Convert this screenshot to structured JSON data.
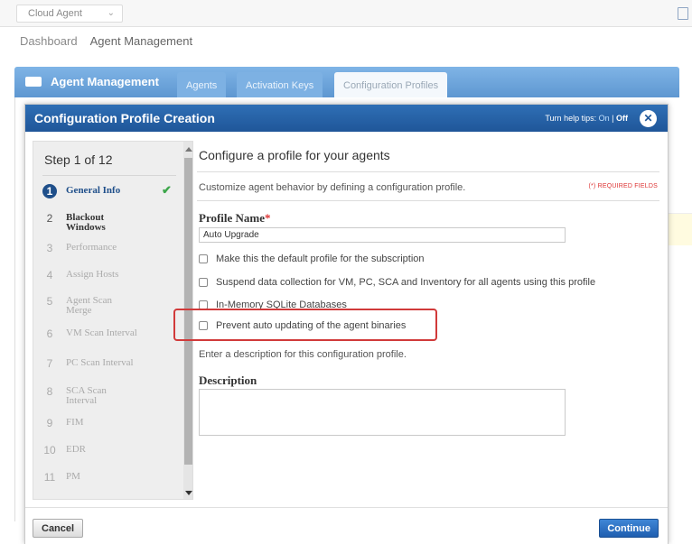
{
  "topbar": {
    "app_name": "Cloud Agent",
    "caret": "⌄",
    "right_icon": "window-icon"
  },
  "breadcrumb": {
    "items": [
      "Dashboard",
      "Agent Management"
    ]
  },
  "module": {
    "title": "Agent Management",
    "icon": "folder-icon",
    "tabs": [
      "Agents",
      "Activation Keys",
      "Configuration Profiles"
    ],
    "active_tab": "Configuration Profiles"
  },
  "modal": {
    "title": "Configuration Profile Creation",
    "help_tips": {
      "label": "Turn help tips:",
      "on": "On",
      "sep": "|",
      "off": "Off"
    },
    "close_glyph": "✕",
    "steps": {
      "heading": "Step 1 of 12",
      "items": [
        {
          "num": "1",
          "label": "General Info",
          "state": "done"
        },
        {
          "num": "2",
          "label": "Blackout Windows",
          "state": "active"
        },
        {
          "num": "3",
          "label": "Performance",
          "state": "pending"
        },
        {
          "num": "4",
          "label": "Assign Hosts",
          "state": "pending"
        },
        {
          "num": "5",
          "label": "Agent Scan Merge",
          "state": "pending"
        },
        {
          "num": "6",
          "label": "VM Scan Interval",
          "state": "pending"
        },
        {
          "num": "7",
          "label": "PC Scan Interval",
          "state": "pending"
        },
        {
          "num": "8",
          "label": "SCA Scan Interval",
          "state": "pending"
        },
        {
          "num": "9",
          "label": "FIM",
          "state": "pending"
        },
        {
          "num": "10",
          "label": "EDR",
          "state": "pending"
        },
        {
          "num": "11",
          "label": "PM",
          "state": "pending"
        }
      ],
      "check_glyph": "✔"
    },
    "form": {
      "heading": "Configure a profile for your agents",
      "subheading": "Customize agent behavior by defining a configuration profile.",
      "required_note": "(*) REQUIRED FIELDS",
      "profile_name_label": "Profile Name",
      "required_star": "*",
      "profile_name_value": "Auto Upgrade",
      "checkboxes": [
        "Make this the default profile for the subscription",
        "Suspend data collection for VM, PC, SCA and Inventory for all agents using this profile",
        "In-Memory SQLite Databases",
        "Prevent auto updating of the agent binaries"
      ],
      "description_hint": "Enter a description for this configuration profile.",
      "description_label": "Description",
      "description_value": ""
    },
    "footer": {
      "cancel_label": "Cancel",
      "continue_label": "Continue"
    }
  },
  "colors": {
    "header_blue": "#1f5699",
    "module_blue": "#6aa3db",
    "highlight_red": "#d13a3a",
    "check_green": "#3ca64a"
  }
}
